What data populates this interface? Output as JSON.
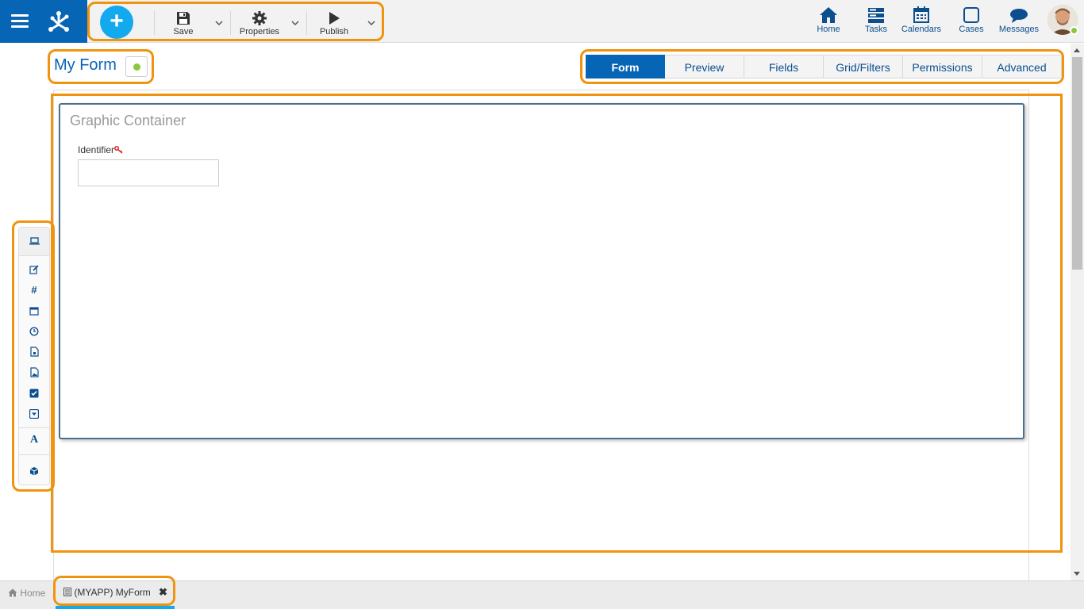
{
  "topbar": {
    "toolbar": {
      "save_label": "Save",
      "properties_label": "Properties",
      "publish_label": "Publish"
    },
    "nav": [
      {
        "label": "Home",
        "icon": "home-icon"
      },
      {
        "label": "Tasks",
        "icon": "tasks-icon"
      },
      {
        "label": "Calendars",
        "icon": "calendar-icon"
      },
      {
        "label": "Cases",
        "icon": "cases-icon"
      },
      {
        "label": "Messages",
        "icon": "messages-icon"
      }
    ]
  },
  "form": {
    "title": "My Form",
    "status_color": "#8dc63f"
  },
  "tabs": [
    {
      "label": "Form",
      "active": true
    },
    {
      "label": "Preview",
      "active": false
    },
    {
      "label": "Fields",
      "active": false
    },
    {
      "label": "Grid/Filters",
      "active": false
    },
    {
      "label": "Permissions",
      "active": false
    },
    {
      "label": "Advanced",
      "active": false
    }
  ],
  "canvas": {
    "container_title": "Graphic Container",
    "field_label": "Identifier",
    "field_value": ""
  },
  "palette": [
    "laptop-icon",
    "edit-icon",
    "hash-icon",
    "calendar-icon",
    "clock-icon",
    "file-icon",
    "image-icon",
    "checkbox-icon",
    "dropdown-icon",
    "text-icon",
    "box-icon"
  ],
  "bottombar": {
    "home_label": "Home",
    "doc_tab_label": "(MYAPP) MyForm"
  },
  "colors": {
    "brand": "#0765b5",
    "accent": "#13a9ee",
    "highlight": "#f0930e"
  }
}
